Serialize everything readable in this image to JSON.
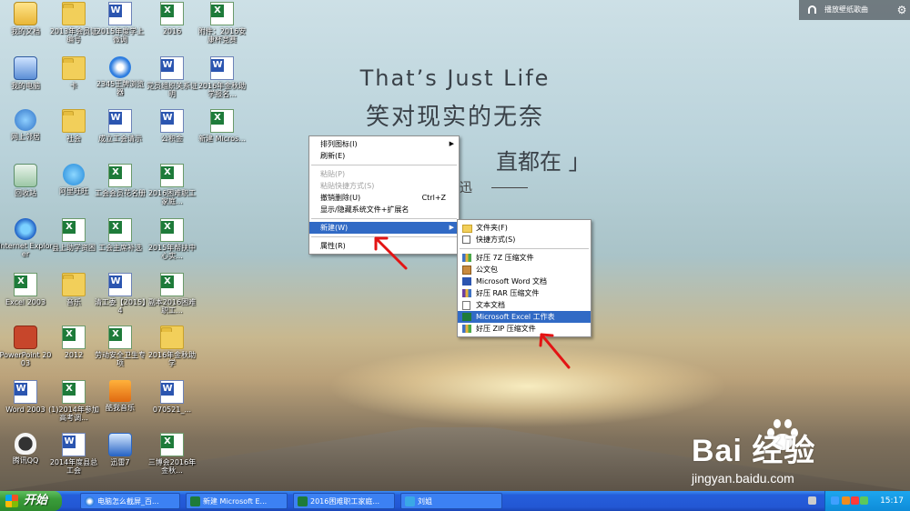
{
  "wallpaper": {
    "line1": "That’s Just Life",
    "line2": "笑对现实的无奈",
    "line3": "直都在 」",
    "line4": "迅"
  },
  "desktop_icons": [
    {
      "label": "我的文档",
      "icon": "my-documents-icon",
      "type": "g-mydoc sys"
    },
    {
      "label": "我的电脑",
      "icon": "my-computer-icon",
      "type": "g-pc sys"
    },
    {
      "label": "网上邻居",
      "icon": "network-icon",
      "type": "g-net"
    },
    {
      "label": "回收站",
      "icon": "recycle-bin-icon",
      "type": "g-bin sys"
    },
    {
      "label": "Internet Explorer",
      "icon": "internet-explorer-icon",
      "type": "g-ie"
    },
    {
      "label": "Excel 2003",
      "icon": "excel-2003-icon",
      "type": "docx"
    },
    {
      "label": "PowerPoint 2003",
      "icon": "powerpoint-2003-icon",
      "type": "g-ppt sys"
    },
    {
      "label": "Word 2003",
      "icon": "word-2003-icon",
      "type": "docw"
    },
    {
      "label": "腾讯QQ",
      "icon": "qq-icon",
      "type": "g-qq"
    },
    {
      "label": "2013年会员证编号",
      "icon": "folder-icon",
      "type": "folder"
    },
    {
      "label": "卡",
      "icon": "folder-icon",
      "type": "folder"
    },
    {
      "label": "社会",
      "icon": "folder-icon",
      "type": "folder"
    },
    {
      "label": "阿里旺旺",
      "icon": "aliwangwang-icon",
      "type": "g-ali"
    },
    {
      "label": "县上助学资困",
      "icon": "excel-file-icon",
      "type": "docx"
    },
    {
      "label": "音乐",
      "icon": "folder-icon",
      "type": "folder"
    },
    {
      "label": "2012",
      "icon": "excel-file-icon",
      "type": "docx"
    },
    {
      "label": "(1)2014年参加高考调...",
      "icon": "excel-file-icon",
      "type": "docx"
    },
    {
      "label": "2014年度县总工会",
      "icon": "word-file-icon",
      "type": "docw"
    },
    {
      "label": "2015年度学上微调",
      "icon": "word-file-icon",
      "type": "docw"
    },
    {
      "label": "2345王牌浏览器",
      "icon": "2345-browser-icon",
      "type": "g-browser"
    },
    {
      "label": "成立工会请示",
      "icon": "word-file-icon",
      "type": "docw"
    },
    {
      "label": "工会会员花名册",
      "icon": "excel-file-icon",
      "type": "docx"
    },
    {
      "label": "工会主席补选",
      "icon": "excel-file-icon",
      "type": "docx"
    },
    {
      "label": "清工委【2015】4",
      "icon": "word-file-icon",
      "type": "docw"
    },
    {
      "label": "劳动安全卫生专项",
      "icon": "excel-file-icon",
      "type": "docx"
    },
    {
      "label": "酷我音乐",
      "icon": "kuwo-music-icon",
      "type": "g-music"
    },
    {
      "label": "迅雷7",
      "icon": "xunlei-icon",
      "type": "g-xl sys"
    },
    {
      "label": "2016",
      "icon": "excel-file-icon",
      "type": "docx"
    },
    {
      "label": "党员组织关系证明",
      "icon": "word-file-icon",
      "type": "docw"
    },
    {
      "label": "公积金",
      "icon": "word-file-icon",
      "type": "docw"
    },
    {
      "label": "2016困难职工家庭...",
      "icon": "excel-file-icon",
      "type": "docx"
    },
    {
      "label": "2015年帮扶中心实...",
      "icon": "excel-file-icon",
      "type": "docx"
    },
    {
      "label": "副本2016困难职工...",
      "icon": "excel-file-icon",
      "type": "docx"
    },
    {
      "label": "2016年金秋助学",
      "icon": "folder-icon",
      "type": "folder"
    },
    {
      "label": "070521_...",
      "icon": "word-file-icon",
      "type": "docw"
    },
    {
      "label": "三博会2016年金秋...",
      "icon": "excel-file-icon",
      "type": "docx"
    },
    {
      "label": "附件：2016安康杯竞赛",
      "icon": "excel-file-icon",
      "type": "docx"
    },
    {
      "label": "2016年金秋助学报名...",
      "icon": "word-file-icon",
      "type": "docw"
    },
    {
      "label": "新建 Micros...",
      "icon": "excel-file-icon",
      "type": "docx"
    }
  ],
  "context_menu": {
    "arrange_icons": "排列图标(I)",
    "refresh": "刷新(E)",
    "paste": "粘贴(P)",
    "paste_shortcut": "粘贴快捷方式(S)",
    "undo_delete": "撤销删除(U)",
    "undo_shortcut": "Ctrl+Z",
    "show_hide": "显示/隐藏系统文件+扩展名",
    "new": "新建(W)",
    "properties": "属性(R)"
  },
  "new_submenu": {
    "folder": "文件夹(F)",
    "shortcut": "快捷方式(S)",
    "haozip_7z": "好压 7Z 压缩文件",
    "briefcase": "公文包",
    "word_doc": "Microsoft Word 文档",
    "haozip_rar": "好压 RAR 压缩文件",
    "text_doc": "文本文档",
    "excel_sheet": "Microsoft Excel 工作表",
    "haozip_zip": "好压 ZIP 压缩文件"
  },
  "top_right": {
    "music_label": "播放壁纸歌曲",
    "settings_glyph": "⚙"
  },
  "taskbar": {
    "start_label": "开始",
    "buttons": [
      {
        "label": "电脑怎么截屏_百..."
      },
      {
        "label": "新建 Microsoft E..."
      },
      {
        "label": "2016困难职工家庭..."
      },
      {
        "label": "刘姐"
      }
    ],
    "clock": "15:17"
  },
  "watermark": {
    "main": "Bai  经验",
    "sub": "jingyan.baidu.com"
  },
  "annotation_color": "#e31414",
  "highlight_color": "#316ac5"
}
